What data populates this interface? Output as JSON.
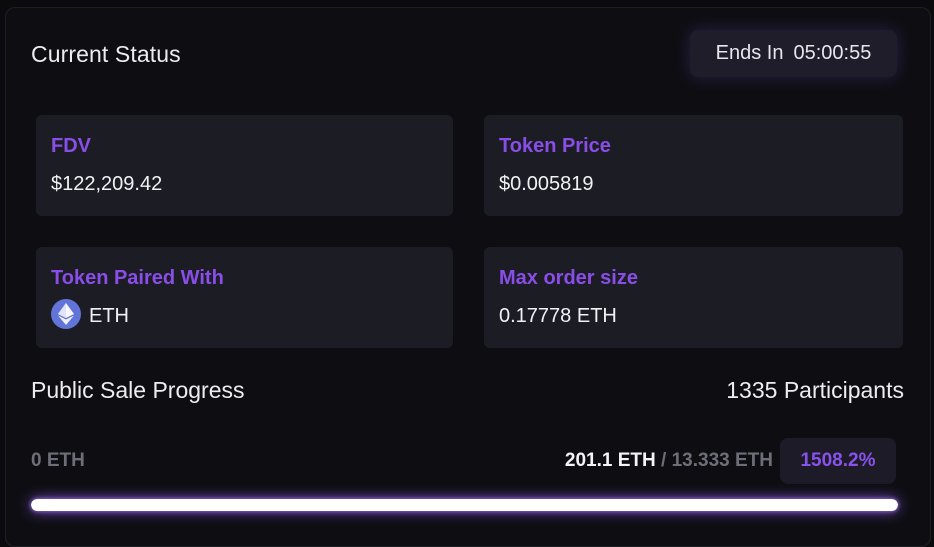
{
  "status": {
    "title": "Current Status",
    "ends_label": "Ends In",
    "ends_time": "05:00:55"
  },
  "cards": [
    {
      "label": "FDV",
      "value": "$122,209.42"
    },
    {
      "label": "Token Price",
      "value": "$0.005819"
    },
    {
      "label": "Token Paired With",
      "value": "ETH",
      "icon": "ethereum-icon"
    },
    {
      "label": "Max order size",
      "value": "0.17778 ETH"
    }
  ],
  "sale": {
    "title": "Public Sale Progress",
    "participants": "1335 Participants",
    "min_label": "0 ETH",
    "raised": "201.1 ETH",
    "separator": " / ",
    "target": "13.333 ETH",
    "percent": "1508.2%",
    "progress_fraction": 1.0
  },
  "colors": {
    "accent": "#8a4ee8",
    "progress_glow": "#9a5cff",
    "eth_icon_bg": "#6274d8"
  }
}
